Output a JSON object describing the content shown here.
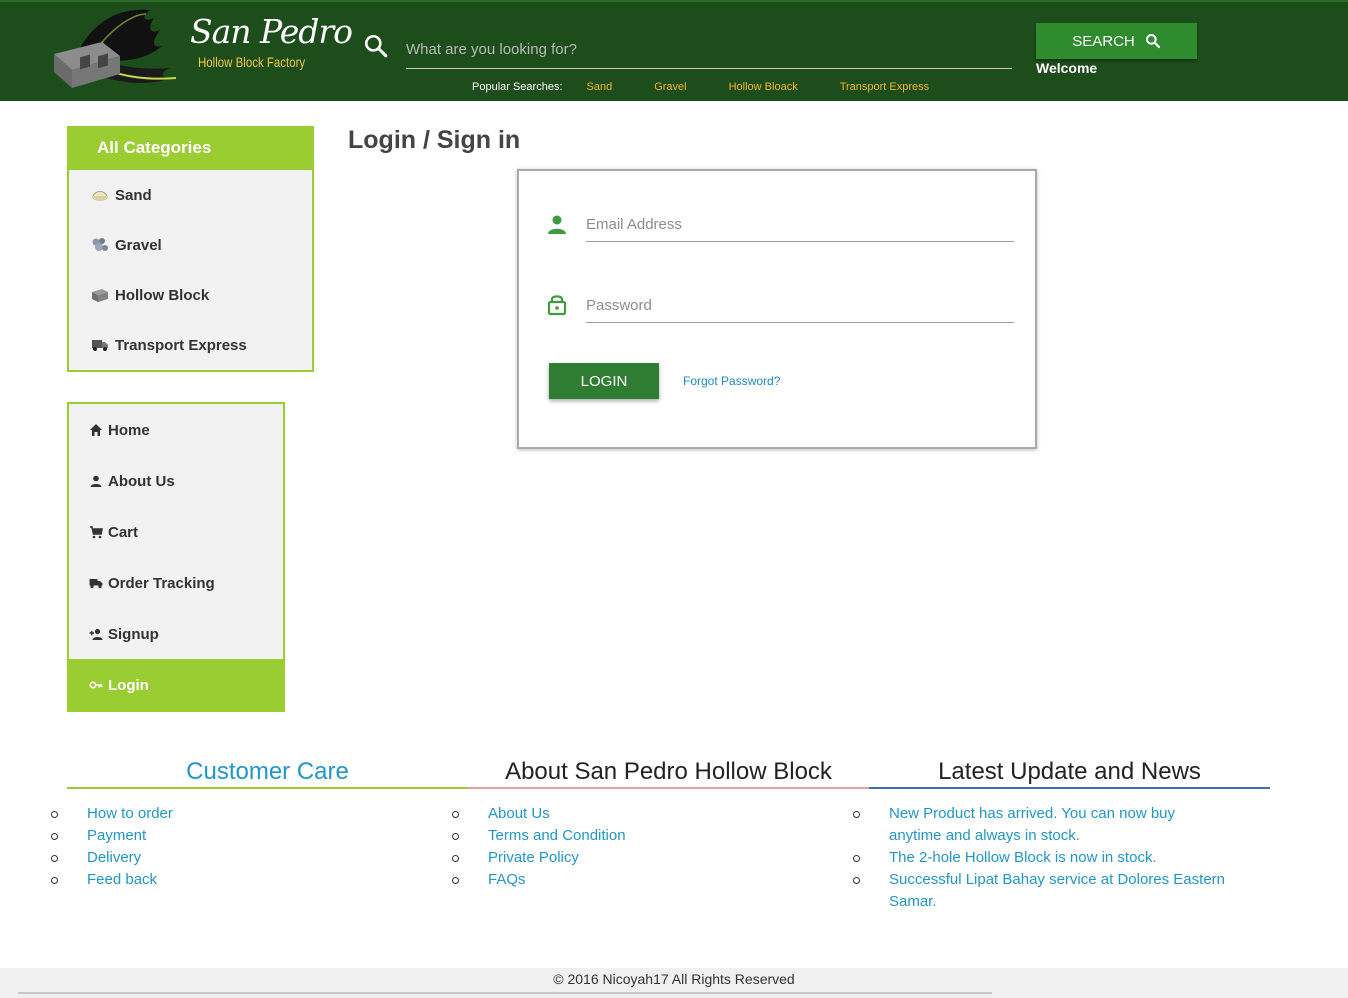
{
  "header": {
    "logo_title": "San Pedro",
    "logo_subtitle": "Hollow Block Factory",
    "search_placeholder": "What are you looking for?",
    "search_button": "SEARCH",
    "welcome": "Welcome",
    "popular_label": "Popular Searches:",
    "popular": [
      "Sand",
      "Gravel",
      "Hollow Bloack",
      "Transport Express"
    ]
  },
  "categories": {
    "title": "All Categories",
    "items": [
      {
        "label": "Sand",
        "icon": "sand-icon"
      },
      {
        "label": "Gravel",
        "icon": "gravel-icon"
      },
      {
        "label": "Hollow Block",
        "icon": "hollow-block-icon"
      },
      {
        "label": "Transport Express",
        "icon": "truck-icon"
      }
    ]
  },
  "nav": {
    "items": [
      {
        "label": "Home",
        "icon": "home-icon"
      },
      {
        "label": "About Us",
        "icon": "person-icon"
      },
      {
        "label": "Cart",
        "icon": "cart-icon"
      },
      {
        "label": "Order Tracking",
        "icon": "truck-icon"
      },
      {
        "label": "Signup",
        "icon": "person-add-icon"
      },
      {
        "label": "Login",
        "icon": "key-icon"
      }
    ],
    "active": "Login"
  },
  "main": {
    "title": "Login / Sign in",
    "email_placeholder": "Email Address",
    "password_placeholder": "Password",
    "login_button": "LOGIN",
    "forgot_link": "Forgot Password?"
  },
  "footer": {
    "columns": [
      {
        "title": "Customer Care",
        "title_color": "#2196c9",
        "rule_color": "#9acd32",
        "items": [
          "How to order",
          "Payment",
          "Delivery",
          "Feed back"
        ]
      },
      {
        "title": "About San Pedro Hollow Block",
        "title_color": "#222222",
        "rule_color": "#e8a0a0",
        "items": [
          "About Us",
          "Terms and Condition",
          "Private Policy",
          "FAQs"
        ]
      },
      {
        "title": "Latest Update and News",
        "title_color": "#222222",
        "rule_color": "#3f6fb5",
        "items": [
          "New Product has arrived. You can now buy anytime and always in stock.",
          "The 2-hole Hollow Block is now in stock.",
          "Successful Lipat Bahay service at Dolores Eastern Samar."
        ]
      }
    ],
    "copyright": "© 2016 Nicoyah17 All Rights Reserved"
  },
  "colors": {
    "header_bg": "#1d4d1b",
    "accent_green": "#9acd32",
    "button_green": "#2e7d32",
    "link_blue": "#2196c9",
    "popular_orange": "#f0b429"
  }
}
